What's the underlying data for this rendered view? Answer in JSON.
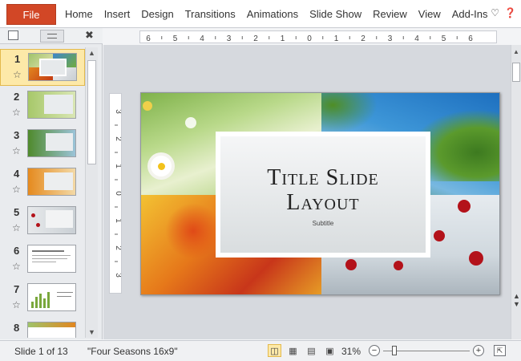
{
  "ribbon": {
    "file_label": "File",
    "tabs": [
      "Home",
      "Insert",
      "Design",
      "Transitions",
      "Animations",
      "Slide Show",
      "Review",
      "View",
      "Add-Ins"
    ]
  },
  "thumbnails": {
    "numbers": [
      "1",
      "2",
      "3",
      "4",
      "5",
      "6",
      "7",
      "8"
    ],
    "star": "☆"
  },
  "slide": {
    "title_line1": "Title Slide",
    "title_line2": "Layout",
    "subtitle": "Subtitle"
  },
  "status": {
    "slide_info": "Slide 1 of 13",
    "theme_name": "\"Four Seasons 16x9\"",
    "zoom": "31%"
  },
  "rulers": {
    "horizontal": [
      "6",
      "5",
      "4",
      "3",
      "2",
      "1",
      "0",
      "1",
      "2",
      "3",
      "4",
      "5",
      "6"
    ],
    "vertical": [
      "3",
      "2",
      "1",
      "0",
      "1",
      "2",
      "3"
    ]
  },
  "icons": {
    "help": "help-icon",
    "minimize_ribbon": "chevron-down-icon",
    "close_pane": "close-icon"
  }
}
